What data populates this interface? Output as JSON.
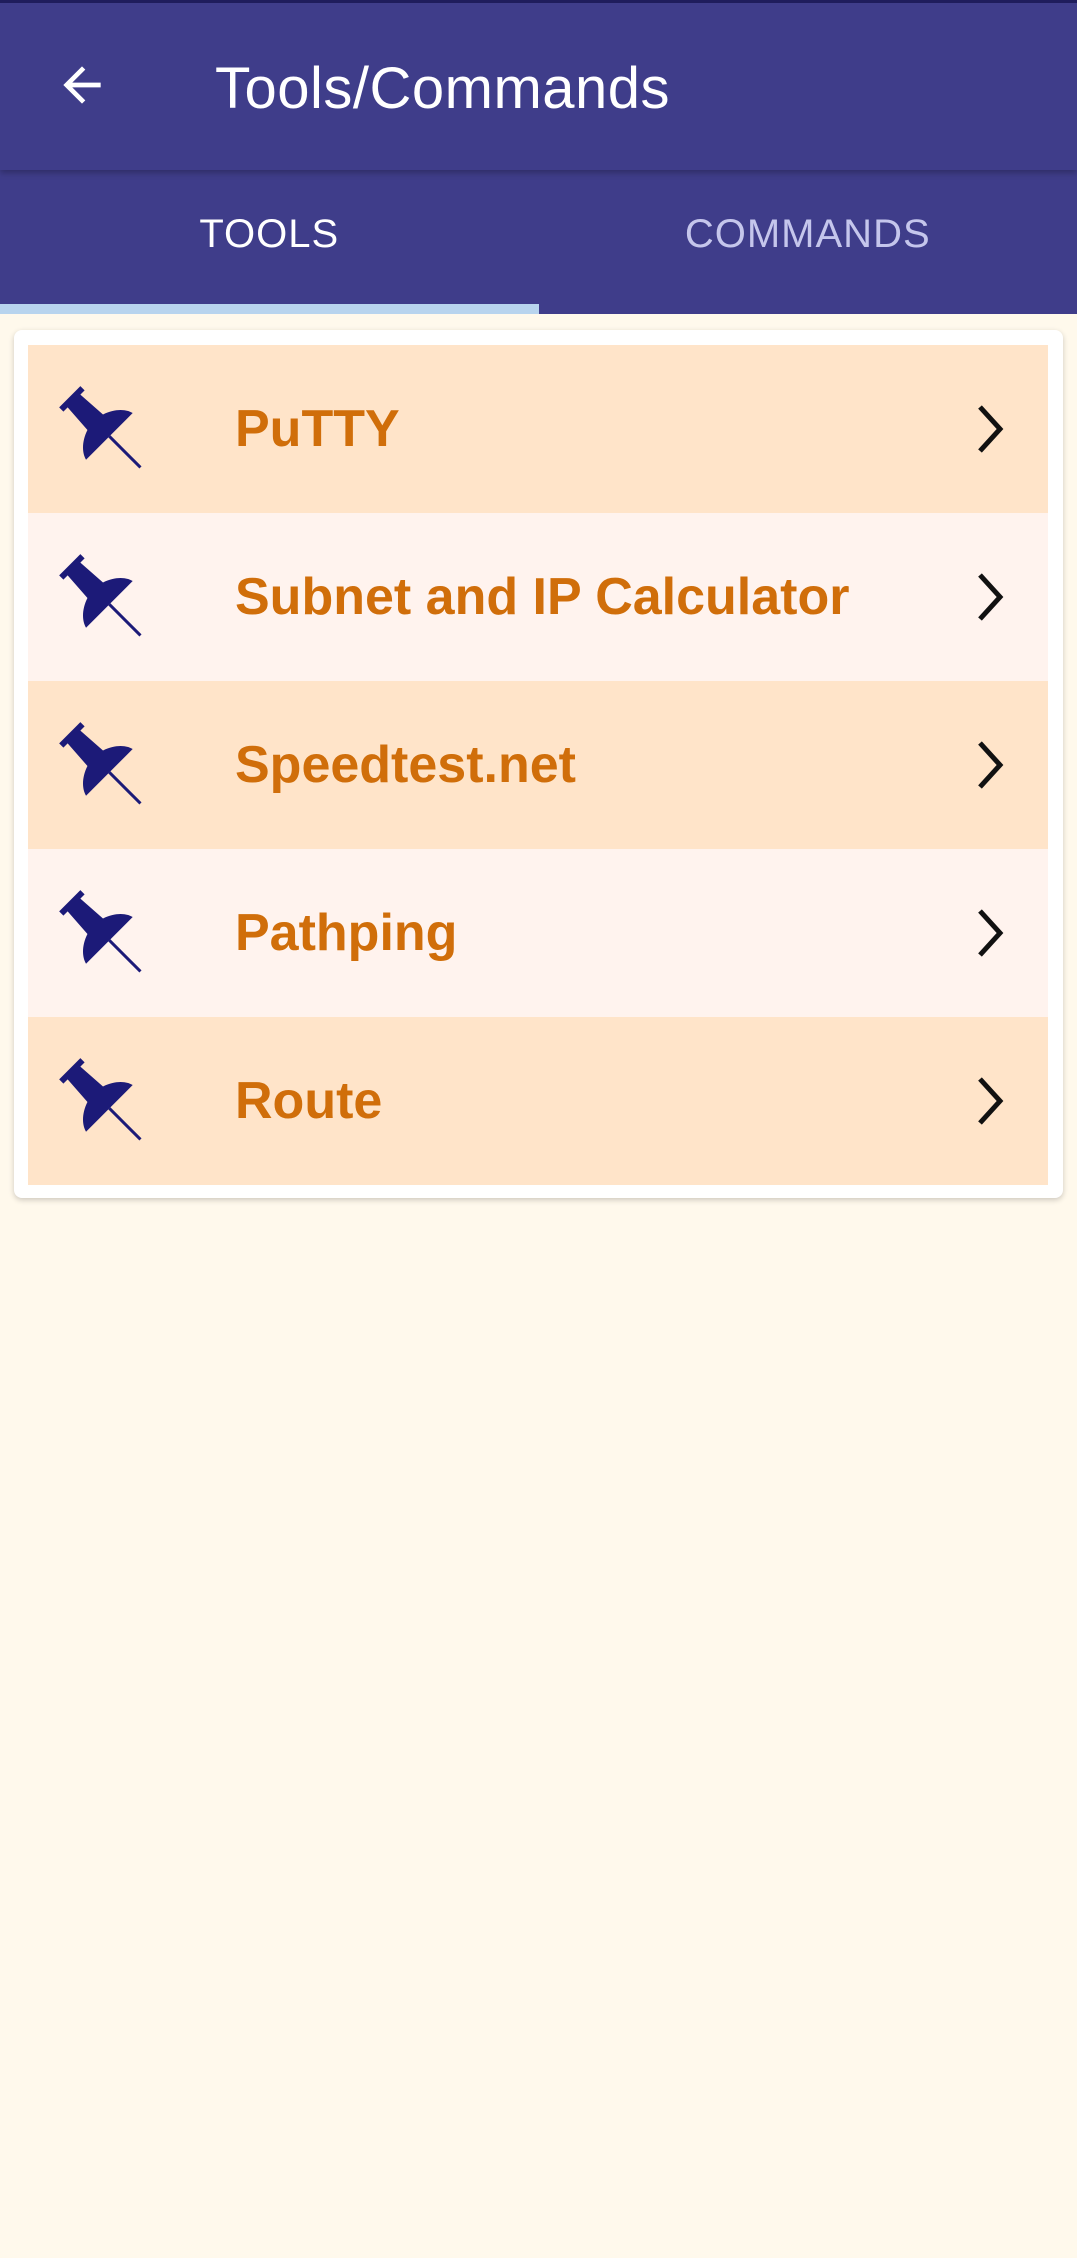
{
  "appbar": {
    "title": "Tools/Commands",
    "back_icon": "arrow-left-icon"
  },
  "tabs": [
    {
      "label": "TOOLS",
      "active": true
    },
    {
      "label": "COMMANDS",
      "active": false
    }
  ],
  "tools": [
    {
      "label": "PuTTY",
      "icon": "pushpin-icon"
    },
    {
      "label": "Subnet and IP Calculator",
      "icon": "pushpin-icon"
    },
    {
      "label": "Speedtest.net",
      "icon": "pushpin-icon"
    },
    {
      "label": "Pathping",
      "icon": "pushpin-icon"
    },
    {
      "label": "Route",
      "icon": "pushpin-icon"
    }
  ],
  "colors": {
    "appbar": "#3f3d8a",
    "tab_indicator": "#b8d4ee",
    "row_odd": "#ffe4c9",
    "row_even": "#fff3ee",
    "label": "#d06e0a",
    "pin": "#1c1a78",
    "background": "#fff9ec"
  }
}
